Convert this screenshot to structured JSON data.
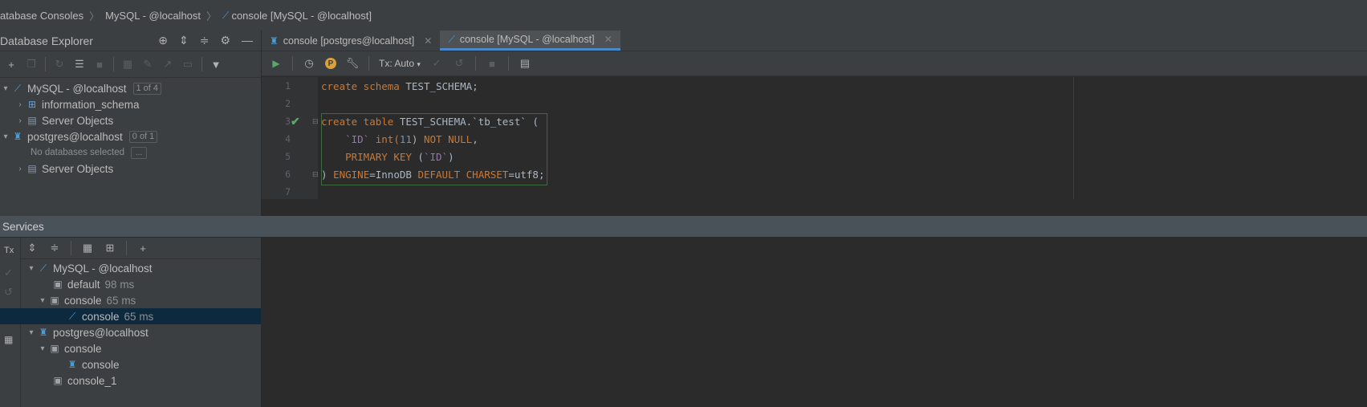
{
  "breadcrumb": {
    "items": [
      "atabase Consoles",
      "MySQL - @localhost",
      "console [MySQL - @localhost]"
    ]
  },
  "explorer": {
    "title": "Database Explorer",
    "tree": {
      "mysql": {
        "label": "MySQL - @localhost",
        "badge": "1 of 4"
      },
      "information_schema": {
        "label": "information_schema"
      },
      "mysql_server_objects": {
        "label": "Server Objects"
      },
      "postgres": {
        "label": "postgres@localhost",
        "badge": "0 of 1"
      },
      "no_db": {
        "label": "No databases selected",
        "dots": "..."
      },
      "pg_server_objects": {
        "label": "Server Objects"
      }
    }
  },
  "editor": {
    "tabs": [
      {
        "label": "console [postgres@localhost]"
      },
      {
        "label": "console [MySQL - @localhost]"
      }
    ],
    "toolbar": {
      "tx_label": "Tx: Auto"
    },
    "line_numbers": [
      "1",
      "2",
      "3",
      "4",
      "5",
      "6",
      "7"
    ],
    "code": {
      "l1_kw": "create schema",
      "l1_id": " TEST_SCHEMA;",
      "l3_kw": "create table",
      "l3_id": " TEST_SCHEMA.`tb_test` (",
      "l4_indent": "    ",
      "l4_col": "`ID`",
      "l4_type": " int(",
      "l4_num": "11",
      "l4_close": ")",
      "l4_kw": " NOT NULL",
      "l4_tail": ",",
      "l5_indent": "    ",
      "l5_kw": "PRIMARY KEY",
      "l5_open": " (",
      "l5_col": "`ID`",
      "l5_close": ")",
      "l6_paren": ") ",
      "l6_kw1": "ENGINE",
      "l6_eq1": "=InnoDB ",
      "l6_kw2": "DEFAULT CHARSET",
      "l6_eq2": "=utf8;"
    }
  },
  "services": {
    "title": "Services",
    "tx_label": "Tx",
    "tree": {
      "mysql": {
        "label": "MySQL - @localhost"
      },
      "default": {
        "label": "default",
        "time": "98 ms"
      },
      "console_group": {
        "label": "console",
        "time": "65 ms"
      },
      "console_session": {
        "label": "console",
        "time": "65 ms"
      },
      "postgres": {
        "label": "postgres@localhost"
      },
      "pg_console_group": {
        "label": "console"
      },
      "pg_console_session": {
        "label": "console"
      },
      "pg_console_1": {
        "label": "console_1"
      }
    }
  },
  "colors": {
    "accent": "#4a88c7",
    "selection": "#0d293e",
    "keyword": "#cc7832",
    "run_green": "#59a869"
  }
}
